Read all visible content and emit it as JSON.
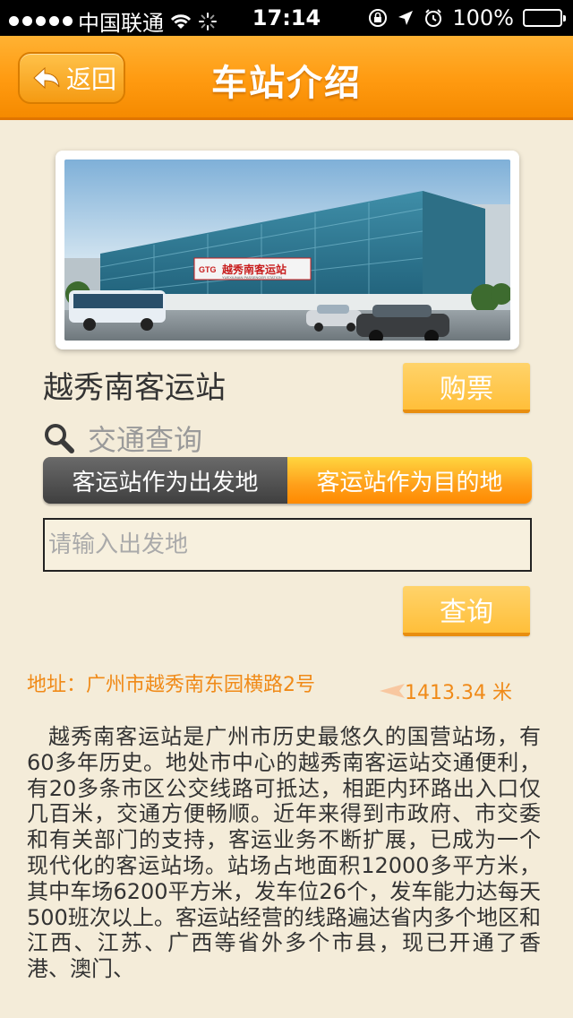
{
  "status_bar": {
    "carrier": "中国联通",
    "time": "17:14",
    "battery": "100%",
    "battery_level": 1.0
  },
  "nav": {
    "back_label": "返回",
    "title": "车站介绍"
  },
  "station": {
    "name": "越秀南客运站",
    "buy_label": "购票"
  },
  "traffic": {
    "label": "交通查询",
    "tabs": [
      {
        "label": "客运站作为出发地",
        "selected": false
      },
      {
        "label": "客运站作为目的地",
        "selected": true
      }
    ],
    "input_value": "",
    "input_placeholder": "请输入出发地",
    "query_label": "查询"
  },
  "address": {
    "text": "地址：广州市越秀南东园横路2号",
    "distance": "1413.34 米"
  },
  "description": "越秀南客运站是广州市历史最悠久的国营站场，有60多年历史。地处市中心的越秀南客运站交通便利，有20多条市区公交线路可抵达，相距内环路出入口仅几百米，交通方便畅顺。近年来得到市政府、市交委和有关部门的支持，客运业务不断扩展，已成为一个现代化的客运站场。站场占地面积12000多平方米，其中车场6200平方米，发车位26个，发车能力达每天500班次以上。客运站经营的线路遍达省内多个地区和江西、江苏、广西等省外多个市县，现已开通了香港、澳门、",
  "colors": {
    "accent": "#ff9a10",
    "text_orange": "#f08a18",
    "background": "#f4ecd9"
  },
  "photo": {
    "sign_brand": "GTG",
    "sign_text": "越秀南客运站",
    "sign_subtext": "YUEXIUNAN PASSENGER STATION"
  }
}
